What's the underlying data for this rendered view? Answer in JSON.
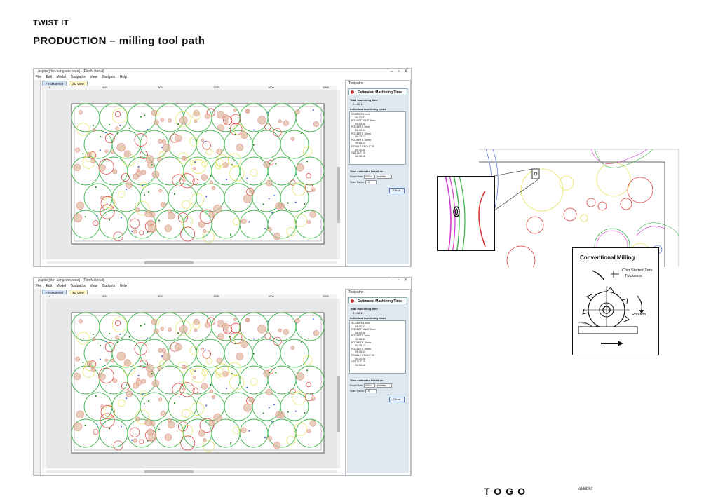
{
  "header": {
    "subtitle": "TWIST IT",
    "title": "PRODUCTION – milling tool path"
  },
  "windows": [
    {
      "title": "Aspire [dvn-kang-wsc wan] - [FirstMaterial]",
      "menu": [
        "File",
        "Edit",
        "Model",
        "Toolpaths",
        "View",
        "Gadgets",
        "Help"
      ],
      "tabs": [
        "FirstMaterial",
        "3D View"
      ],
      "ruler_ticks": [
        "0",
        "400",
        "800",
        "1200",
        "1600",
        "2000"
      ],
      "panel": {
        "title": "Toolpaths",
        "header": "Estimated Machining Time",
        "total_label": "Total machining time",
        "total_value": "21:48:11",
        "individual_label": "Individual machining times",
        "items": [
          "SCREWS 15mm",
          "00:00:37",
          "POCKET MALE 3mm",
          "00:00:48",
          "POCKETS 3mm",
          "00:05:41",
          "POCKETS 10mm",
          "00:15:17",
          "POCKETS 15mm",
          "00:05:01",
          "FEMALE ENOUT 20",
          "00:10:28",
          "OUTCUT 20",
          "00:30:28"
        ],
        "based_label": "Time estimates based on ...",
        "rapid_label": "Rapid Rate",
        "rapid_value": "4000.0",
        "units": "mm/min",
        "scale_label": "Scale Factor",
        "scale_value": "1.5",
        "close": "Close"
      }
    },
    {
      "title": "Aspire [dvn-kang-wsc wan] - [FirstMaterial]",
      "menu": [
        "File",
        "Edit",
        "Model",
        "Toolpaths",
        "View",
        "Gadgets",
        "Help"
      ],
      "tabs": [
        "FirstMaterial",
        "3D View"
      ],
      "ruler_ticks": [
        "0",
        "400",
        "800",
        "1200",
        "1600",
        "2000"
      ],
      "panel": {
        "title": "Toolpaths",
        "header": "Estimated Machining Time",
        "total_label": "Total machining time",
        "total_value": "21:48:11",
        "individual_label": "Individual machining times",
        "items": [
          "SCREWS 15mm",
          "00:00:37",
          "POCKET MALE 3mm",
          "00:00:48",
          "POCKETS 3mm",
          "00:05:41",
          "POCKETS 10mm",
          "00:15:17",
          "POCKETS 15mm",
          "00:05:01",
          "FEMALE ENOUT 20",
          "00:10:28",
          "OUTCUT 20",
          "00:30:28"
        ],
        "based_label": "Time estimates based on ...",
        "rapid_label": "Rapid Rate",
        "rapid_value": "4000.0",
        "units": "mm/min",
        "scale_label": "Scale Factor",
        "scale_value": "1.5",
        "close": "Close"
      }
    }
  ],
  "diagram": {
    "title": "Conventional Milling",
    "chip_label_1": "Chip Started Zero",
    "chip_label_2": "Thickness",
    "rotation_label": "Rotation"
  },
  "footer": {
    "logo": "TOGO",
    "tag": "kit/kit/kit"
  },
  "colors": {
    "green": "#3cb44b",
    "red": "#d83a3a",
    "yellow": "#e8e35a",
    "magenta": "#d23cd2",
    "blue": "#3b5bd6",
    "tan": "#e0b8a0"
  }
}
